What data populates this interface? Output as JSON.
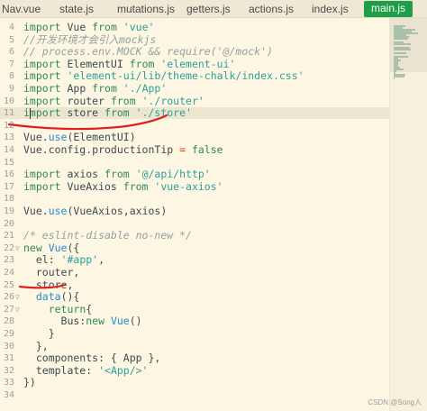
{
  "tabs": [
    {
      "label": "Nav.vue",
      "active": false
    },
    {
      "label": "state.js",
      "active": false
    },
    {
      "label": "mutations.js",
      "active": false
    },
    {
      "label": "getters.js",
      "active": false
    },
    {
      "label": "actions.js",
      "active": false
    },
    {
      "label": "index.js",
      "active": false
    },
    {
      "label": "main.js",
      "active": true
    }
  ],
  "code_lines": [
    {
      "n": "4",
      "parts": [
        [
          "kw",
          "import "
        ],
        [
          "tx",
          "Vue "
        ],
        [
          "kw",
          "from "
        ],
        [
          "str",
          "'vue'"
        ]
      ]
    },
    {
      "n": "5",
      "parts": [
        [
          "cm",
          "//开发环境才会引入mockjs"
        ]
      ]
    },
    {
      "n": "6",
      "parts": [
        [
          "cm",
          "// process.env.MOCK && require('@/mock')"
        ]
      ]
    },
    {
      "n": "7",
      "parts": [
        [
          "kw",
          "import "
        ],
        [
          "tx",
          "ElementUI "
        ],
        [
          "kw",
          "from "
        ],
        [
          "str",
          "'element-ui'"
        ]
      ]
    },
    {
      "n": "8",
      "parts": [
        [
          "kw",
          "import "
        ],
        [
          "str",
          "'element-ui/lib/theme-chalk/index.css'"
        ]
      ]
    },
    {
      "n": "9",
      "parts": [
        [
          "kw",
          "import "
        ],
        [
          "tx",
          "App "
        ],
        [
          "kw",
          "from "
        ],
        [
          "str",
          "'./App'"
        ]
      ]
    },
    {
      "n": "10",
      "parts": [
        [
          "kw",
          "import "
        ],
        [
          "tx",
          "router "
        ],
        [
          "kw",
          "from "
        ],
        [
          "str",
          "'./router'"
        ]
      ]
    },
    {
      "n": "11",
      "parts": [
        [
          "kw",
          "import "
        ],
        [
          "tx",
          "store "
        ],
        [
          "kw",
          "from "
        ],
        [
          "str",
          "'./store'"
        ]
      ],
      "highlight": true
    },
    {
      "n": "12",
      "parts": []
    },
    {
      "n": "13",
      "parts": [
        [
          "tx",
          "Vue."
        ],
        [
          "fn",
          "use"
        ],
        [
          "tx",
          "(ElementUI)"
        ]
      ]
    },
    {
      "n": "14",
      "parts": [
        [
          "tx",
          "Vue.config.productionTip "
        ],
        [
          "op",
          "= "
        ],
        [
          "kw",
          "false"
        ]
      ]
    },
    {
      "n": "15",
      "parts": []
    },
    {
      "n": "16",
      "parts": [
        [
          "kw",
          "import "
        ],
        [
          "tx",
          "axios "
        ],
        [
          "kw",
          "from "
        ],
        [
          "str",
          "'@/api/http'"
        ]
      ]
    },
    {
      "n": "17",
      "parts": [
        [
          "kw",
          "import "
        ],
        [
          "tx",
          "VueAxios "
        ],
        [
          "kw",
          "from "
        ],
        [
          "str",
          "'vue-axios'"
        ]
      ]
    },
    {
      "n": "18",
      "parts": []
    },
    {
      "n": "19",
      "parts": [
        [
          "tx",
          "Vue."
        ],
        [
          "fn",
          "use"
        ],
        [
          "tx",
          "(VueAxios,axios)"
        ]
      ]
    },
    {
      "n": "20",
      "parts": []
    },
    {
      "n": "21",
      "parts": [
        [
          "cm",
          "/* eslint-disable no-new */"
        ]
      ]
    },
    {
      "n": "22",
      "parts": [
        [
          "kw",
          "new "
        ],
        [
          "fn",
          "Vue"
        ],
        [
          "tx",
          "({"
        ]
      ],
      "fold": true
    },
    {
      "n": "23",
      "parts": [
        [
          "tx",
          "  el: "
        ],
        [
          "str",
          "'#app'"
        ],
        [
          "tx",
          ","
        ]
      ]
    },
    {
      "n": "24",
      "parts": [
        [
          "tx",
          "  router,"
        ]
      ]
    },
    {
      "n": "25",
      "parts": [
        [
          "tx",
          "  store,"
        ]
      ]
    },
    {
      "n": "26",
      "parts": [
        [
          "tx",
          "  "
        ],
        [
          "fn",
          "data"
        ],
        [
          "tx",
          "(){"
        ]
      ],
      "fold": true
    },
    {
      "n": "27",
      "parts": [
        [
          "tx",
          "    "
        ],
        [
          "kw",
          "return"
        ],
        [
          "tx",
          "{"
        ]
      ],
      "fold": true
    },
    {
      "n": "28",
      "parts": [
        [
          "tx",
          "      Bus:"
        ],
        [
          "kw",
          "new "
        ],
        [
          "fn",
          "Vue"
        ],
        [
          "tx",
          "()"
        ]
      ]
    },
    {
      "n": "29",
      "parts": [
        [
          "tx",
          "    }"
        ]
      ]
    },
    {
      "n": "30",
      "parts": [
        [
          "tx",
          "  },"
        ]
      ]
    },
    {
      "n": "31",
      "parts": [
        [
          "tx",
          "  components: { App },"
        ]
      ]
    },
    {
      "n": "32",
      "parts": [
        [
          "tx",
          "  template: "
        ],
        [
          "str",
          "'<App/>'"
        ]
      ]
    },
    {
      "n": "33",
      "parts": [
        [
          "tx",
          "})"
        ]
      ]
    },
    {
      "n": "34",
      "parts": []
    }
  ],
  "watermark": "CSDN @Song人",
  "colors": {
    "active_tab": "#1f9e4a",
    "annotation": "#e02020",
    "background": "#fdf6e3"
  }
}
